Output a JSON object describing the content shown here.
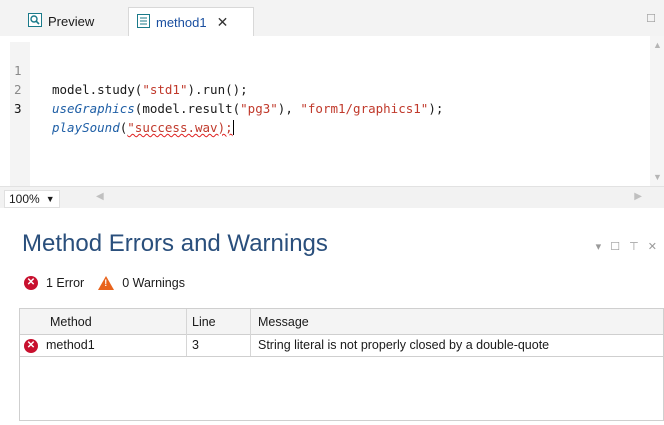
{
  "tabs": [
    {
      "label": "Preview",
      "icon": "preview-icon",
      "active": false
    },
    {
      "label": "method1",
      "icon": "method-file-icon",
      "active": true
    }
  ],
  "editor": {
    "lines": [
      {
        "number": "1",
        "code": "model.study(\"std1\").run();"
      },
      {
        "number": "2",
        "code": "useGraphics(model.result(\"pg3\"), \"form1/graphics1\");"
      },
      {
        "number": "3",
        "code": "playSound(\"success.wav);"
      }
    ],
    "colors": {
      "string": "#c0392b",
      "method": "#1f5fa6",
      "error_underline": "#e02020"
    }
  },
  "zoom": {
    "value": "100%"
  },
  "errors_panel": {
    "title": "Method Errors and Warnings",
    "error_summary": "1 Error",
    "warning_summary": "0 Warnings",
    "columns": [
      "Method",
      "Line",
      "Message"
    ],
    "rows": [
      {
        "method": "method1",
        "line": "3",
        "message": "String literal is not properly closed by a double-quote",
        "severity": "error"
      }
    ],
    "colors": {
      "error": "#c8102e",
      "warning": "#e8631c",
      "title": "#2a4f7c"
    }
  }
}
